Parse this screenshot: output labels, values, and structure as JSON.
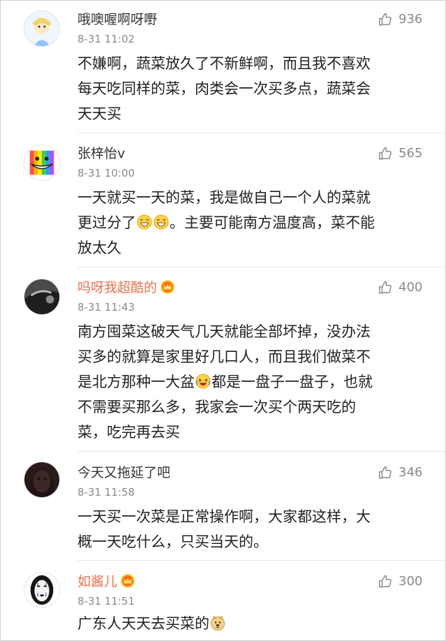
{
  "comments": [
    {
      "username": "哦噢喔啊呀嘢",
      "time": "8-31 11:02",
      "likes": "936",
      "text": [
        "不嫌啊，蔬菜放久了不新鲜啊，而且我不喜欢",
        "每天吃同样的菜，肉类会一次买多点，蔬菜会",
        "天天买"
      ]
    },
    {
      "username": "张梓怡v",
      "time": "8-31 10:00",
      "likes": "565",
      "text": [
        "一天就买一天的菜，我是做自己一个人的菜就",
        "更过分了",
        "。主要可能南方温度高，菜不能",
        "放太久"
      ]
    },
    {
      "username": "吗呀我超酷的",
      "time": "8-31 11:43",
      "likes": "400",
      "text": [
        "南方囤菜这破天气几天就能全部坏掉，没办法",
        "买多的就算是家里好几口人，而且我们做菜不",
        "是北方那种一大盆",
        "都是一盘子一盘子，也就",
        "不需要买那么多，我家会一次买个两天吃的",
        "菜，吃完再去买"
      ]
    },
    {
      "username": "今天又拖延了吧",
      "time": "8-31 11:58",
      "likes": "346",
      "text": [
        "一天买一次菜是正常操作啊，大家都这样，大",
        "概一天吃什么，只买当天的。"
      ]
    },
    {
      "username": "如酱儿",
      "time": "8-31 11:51",
      "likes": "300",
      "text": [
        "广东人天天去买菜的"
      ]
    }
  ],
  "icons": {
    "like": "thumbs-up-outline",
    "vip_badge": "crown-badge",
    "emoji_grin": "grinning-face",
    "emoji_laugh": "laughing-crying-face",
    "emoji_doge": "doge-face"
  },
  "colors": {
    "username": "#333333",
    "vip_username": "#eb7350",
    "meta": "#8a8a8a",
    "body_text": "#222222",
    "divider": "#e6e6e6"
  }
}
